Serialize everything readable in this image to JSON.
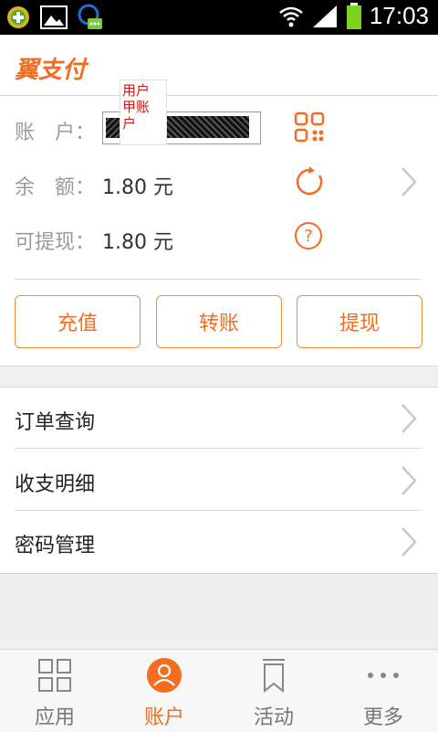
{
  "status_bar": {
    "time": "17:03",
    "icons": [
      "plus-circle-icon",
      "image-icon",
      "chat-icon",
      "wifi-icon",
      "signal-icon",
      "battery-icon"
    ]
  },
  "app": {
    "brand": "翼支付",
    "accent_color": "#f26d21"
  },
  "account": {
    "account_label": "账　户：",
    "account_tooltip_lines": [
      "用户",
      "甲账",
      "户"
    ],
    "balance_label": "余　额：",
    "balance_value": "1.80 元",
    "withdrawable_label": "可提现：",
    "withdrawable_value": "1.80 元",
    "qr_icon": "qr-code-icon",
    "refresh_icon": "refresh-icon",
    "help_icon": "question-icon"
  },
  "actions": {
    "recharge": "充值",
    "transfer": "转账",
    "withdraw": "提现"
  },
  "menu": {
    "items": [
      {
        "label": "订单查询"
      },
      {
        "label": "收支明细"
      },
      {
        "label": "密码管理"
      }
    ]
  },
  "tabs": {
    "items": [
      {
        "label": "应用",
        "icon": "grid-icon",
        "active": false
      },
      {
        "label": "账户",
        "icon": "user-icon",
        "active": true
      },
      {
        "label": "活动",
        "icon": "bookmark-icon",
        "active": false
      },
      {
        "label": "更多",
        "icon": "more-icon",
        "active": false
      }
    ],
    "active_color": "#f26d21",
    "inactive_color": "#777777"
  }
}
